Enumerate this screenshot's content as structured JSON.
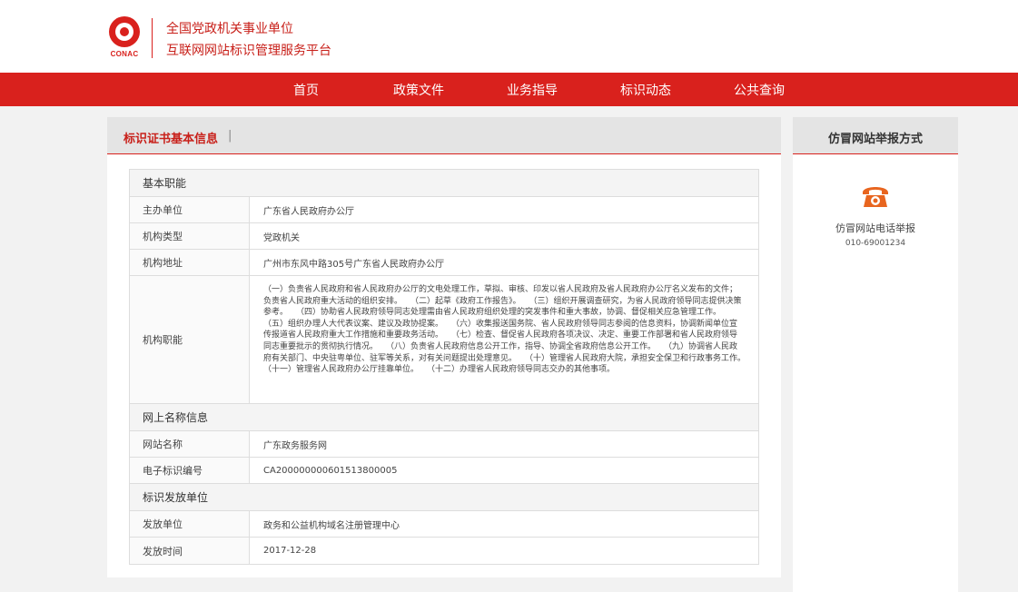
{
  "header": {
    "logo_text": "CONAC",
    "title_line1": "全国党政机关事业单位",
    "title_line2": "互联网网站标识管理服务平台"
  },
  "nav": {
    "items": [
      {
        "label": "首页"
      },
      {
        "label": "政策文件"
      },
      {
        "label": "业务指导"
      },
      {
        "label": "标识动态"
      },
      {
        "label": "公共查询"
      }
    ]
  },
  "main": {
    "heading": "标识证书基本信息",
    "heading_sep": "|",
    "sections": {
      "basic": {
        "title": "基本职能",
        "sponsor_label": "主办单位",
        "sponsor_value": "广东省人民政府办公厅",
        "type_label": "机构类型",
        "type_value": "党政机关",
        "address_label": "机构地址",
        "address_value": "广州市东风中路305号广东省人民政府办公厅",
        "duty_label": "机构职能",
        "duty_value": "（一）负责省人民政府和省人民政府办公厅的文电处理工作，草拟、审核、印发以省人民政府及省人民政府办公厅名义发布的文件；负责省人民政府重大活动的组织安排。　　（二）起草《政府工作报告》。　　（三）组织开展调查研究，为省人民政府领导同志提供决策参考。　　（四）协助省人民政府领导同志处理需由省人民政府组织处理的突发事件和重大事故，协调、督促相关应急管理工作。　　（五）组织办理人大代表议案、建议及政协提案。　　（六）收集报送国务院、省人民政府领导同志参阅的信息资料，协调新闻单位宣传报道省人民政府重大工作措施和重要政务活动。　　（七）检查、督促省人民政府各项决议、决定、重要工作部署和省人民政府领导同志重要批示的贯彻执行情况。　　（八）负责省人民政府信息公开工作，指导、协调全省政府信息公开工作。　　（九）协调省人民政府有关部门、中央驻粤单位、驻军等关系，对有关问题提出处理意见。　　（十）管理省人民政府大院，承担安全保卫和行政事务工作。　　（十一）管理省人民政府办公厅挂靠单位。　　（十二）办理省人民政府领导同志交办的其他事项。"
      },
      "online": {
        "title": "网上名称信息",
        "site_label": "网站名称",
        "site_value": "广东政务服务网",
        "code_label": "电子标识编号",
        "code_value": "CA20000000060151380000​5"
      },
      "issuer": {
        "title": "标识发放单位",
        "unit_label": "发放单位",
        "unit_value": "政务和公益机构域名注册管理中心",
        "time_label": "发放时间",
        "time_value": "2017-12-28"
      }
    }
  },
  "sidebar": {
    "heading": "仿冒网站举报方式",
    "phone_icon": "telephone-icon",
    "phone_label": "仿冒网站电话举报",
    "phone_number": "010-69001234",
    "accent_color": "#e8651f"
  },
  "colors": {
    "brand_red": "#d9211d",
    "page_bg": "#f2f2f2"
  }
}
